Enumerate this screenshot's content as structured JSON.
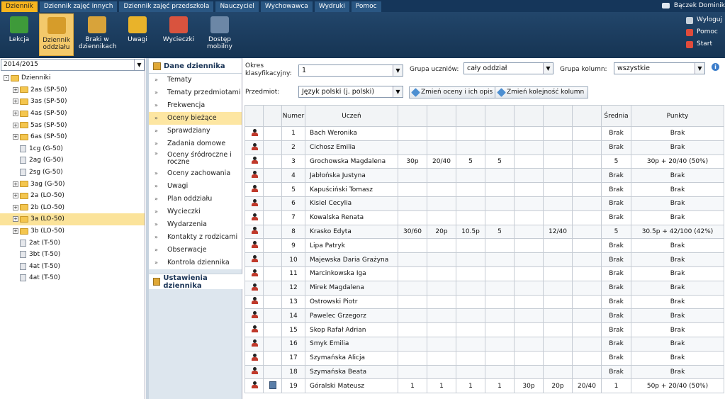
{
  "top_tabs": [
    {
      "label": "Dziennik",
      "active": true
    },
    {
      "label": "Dziennik zajęć innych",
      "active": false
    },
    {
      "label": "Dziennik zajęć przedszkola",
      "active": false
    },
    {
      "label": "Nauczyciel",
      "active": false
    },
    {
      "label": "Wychowawca",
      "active": false
    },
    {
      "label": "Wydruki",
      "active": false
    },
    {
      "label": "Pomoc",
      "active": false
    }
  ],
  "user_name": "Bączek Dominik",
  "toolbar": {
    "buttons": [
      {
        "label1": "Lekcja",
        "label2": "",
        "icon": "blackboard-icon",
        "color": "#3e9a3a"
      },
      {
        "label1": "Dziennik",
        "label2": "oddziału",
        "icon": "book-icon",
        "color": "#d69c2a",
        "active": true
      },
      {
        "label1": "Braki w",
        "label2": "dziennikach",
        "icon": "warning-book-icon",
        "color": "#d8a33a"
      },
      {
        "label1": "Uwagi",
        "label2": "",
        "icon": "note-icon",
        "color": "#e9b32a"
      },
      {
        "label1": "Wycieczki",
        "label2": "",
        "icon": "backpack-icon",
        "color": "#d9533e"
      },
      {
        "label1": "Dostęp",
        "label2": "mobilny",
        "icon": "mobile-icon",
        "color": "#6c87a6"
      }
    ]
  },
  "right_links": [
    {
      "label": "Wyloguj",
      "icon": "lock-icon",
      "color": "#c8d2dc"
    },
    {
      "label": "Pomoc",
      "icon": "lifebuoy-icon",
      "color": "#e04b3b"
    },
    {
      "label": "Start",
      "icon": "home-icon",
      "color": "#e04b3b"
    }
  ],
  "sidebar": {
    "year": "2014/2015",
    "tree": [
      {
        "label": "Dzienniki",
        "level": 0,
        "expander": "-",
        "type": "folder"
      },
      {
        "label": "2as (SP-50)",
        "level": 1,
        "expander": "+",
        "type": "folder"
      },
      {
        "label": "3as (SP-50)",
        "level": 1,
        "expander": "+",
        "type": "folder"
      },
      {
        "label": "4as (SP-50)",
        "level": 1,
        "expander": "+",
        "type": "folder"
      },
      {
        "label": "5as (SP-50)",
        "level": 1,
        "expander": "+",
        "type": "folder"
      },
      {
        "label": "6as (SP-50)",
        "level": 1,
        "expander": "+",
        "type": "folder"
      },
      {
        "label": "1cg (G-50)",
        "level": 1,
        "expander": "",
        "type": "doc"
      },
      {
        "label": "2ag (G-50)",
        "level": 1,
        "expander": "",
        "type": "doc"
      },
      {
        "label": "2sg (G-50)",
        "level": 1,
        "expander": "",
        "type": "doc"
      },
      {
        "label": "3ag (G-50)",
        "level": 1,
        "expander": "+",
        "type": "folder"
      },
      {
        "label": "2a (LO-50)",
        "level": 1,
        "expander": "+",
        "type": "folder"
      },
      {
        "label": "2b (LO-50)",
        "level": 1,
        "expander": "+",
        "type": "folder"
      },
      {
        "label": "3a (LO-50)",
        "level": 1,
        "expander": "+",
        "type": "folder",
        "selected": true
      },
      {
        "label": "3b (LO-50)",
        "level": 1,
        "expander": "+",
        "type": "folder"
      },
      {
        "label": "2at (T-50)",
        "level": 1,
        "expander": "",
        "type": "doc"
      },
      {
        "label": "3bt (T-50)",
        "level": 1,
        "expander": "",
        "type": "doc"
      },
      {
        "label": "4at (T-50)",
        "level": 1,
        "expander": "",
        "type": "doc"
      },
      {
        "label": "4at (T-50)",
        "level": 1,
        "expander": "",
        "type": "doc"
      }
    ]
  },
  "nav": {
    "header": "Dane dziennika",
    "items": [
      {
        "label": "Tematy"
      },
      {
        "label": "Tematy przedmiotami"
      },
      {
        "label": "Frekwencja"
      },
      {
        "label": "Oceny bieżące",
        "active": true
      },
      {
        "label": "Sprawdziany"
      },
      {
        "label": "Zadania domowe"
      },
      {
        "label": "Oceny śródroczne i roczne",
        "double": true
      },
      {
        "label": "Oceny zachowania"
      },
      {
        "label": "Uwagi"
      },
      {
        "label": "Plan oddziału"
      },
      {
        "label": "Wycieczki"
      },
      {
        "label": "Wydarzenia"
      },
      {
        "label": "Kontakty z rodzicami"
      },
      {
        "label": "Obserwacje"
      },
      {
        "label": "Kontrola dziennika"
      }
    ],
    "footer": "Ustawienia dziennika"
  },
  "filters": {
    "okres_label": "Okres klasyfikacyjny:",
    "okres_value": "1",
    "grupa_uczniow_label": "Grupa uczniów:",
    "grupa_uczniow_value": "cały oddział",
    "grupa_kolumn_label": "Grupa kolumn:",
    "grupa_kolumn_value": "wszystkie",
    "przedmiot_label": "Przedmiot:",
    "przedmiot_value": "Język polski (j. polski)",
    "btn_zmien_oceny": "Zmień oceny i ich opis",
    "btn_zmien_kolejnosc": "Zmień kolejność kolumn"
  },
  "table": {
    "headers": [
      "",
      "",
      "Numer",
      "Uczeń",
      "",
      "",
      "",
      "",
      "",
      "",
      "",
      "Średnia",
      "Punkty"
    ],
    "rows": [
      {
        "num": "1",
        "name": "Bach Weronika",
        "grades": [
          "",
          "",
          "",
          "",
          "",
          "",
          ""
        ],
        "avg": "Brak",
        "pts": "Brak"
      },
      {
        "num": "2",
        "name": "Cichosz Emilia",
        "grades": [
          "",
          "",
          "",
          "",
          "",
          "",
          ""
        ],
        "avg": "Brak",
        "pts": "Brak"
      },
      {
        "num": "3",
        "name": "Grochowska Magdalena",
        "grades": [
          "30p",
          "20/40",
          "5",
          "5",
          "",
          "",
          ""
        ],
        "avg": "5",
        "pts": "30p + 20/40 (50%)"
      },
      {
        "num": "4",
        "name": "Jabłońska Justyna",
        "grades": [
          "",
          "",
          "",
          "",
          "",
          "",
          ""
        ],
        "avg": "Brak",
        "pts": "Brak"
      },
      {
        "num": "5",
        "name": "Kapuściński Tomasz",
        "grades": [
          "",
          "",
          "",
          "",
          "",
          "",
          ""
        ],
        "avg": "Brak",
        "pts": "Brak"
      },
      {
        "num": "6",
        "name": "Kisiel Cecylia",
        "grades": [
          "",
          "",
          "",
          "",
          "",
          "",
          ""
        ],
        "avg": "Brak",
        "pts": "Brak"
      },
      {
        "num": "7",
        "name": "Kowalska Renata",
        "grades": [
          "",
          "",
          "",
          "",
          "",
          "",
          ""
        ],
        "avg": "Brak",
        "pts": "Brak"
      },
      {
        "num": "8",
        "name": "Krasko Edyta",
        "grades": [
          "30/60",
          "20p",
          "10.5p",
          "5",
          "",
          "12/40",
          ""
        ],
        "avg": "5",
        "pts": "30.5p + 42/100 (42%)"
      },
      {
        "num": "9",
        "name": "Lipa Patryk",
        "grades": [
          "",
          "",
          "",
          "",
          "",
          "",
          ""
        ],
        "avg": "Brak",
        "pts": "Brak"
      },
      {
        "num": "10",
        "name": "Majewska Daria Grażyna",
        "grades": [
          "",
          "",
          "",
          "",
          "",
          "",
          ""
        ],
        "avg": "Brak",
        "pts": "Brak"
      },
      {
        "num": "11",
        "name": "Marcinkowska Iga",
        "grades": [
          "",
          "",
          "",
          "",
          "",
          "",
          ""
        ],
        "avg": "Brak",
        "pts": "Brak"
      },
      {
        "num": "12",
        "name": "Mirek Magdalena",
        "grades": [
          "",
          "",
          "",
          "",
          "",
          "",
          ""
        ],
        "avg": "Brak",
        "pts": "Brak"
      },
      {
        "num": "13",
        "name": "Ostrowski Piotr",
        "grades": [
          "",
          "",
          "",
          "",
          "",
          "",
          ""
        ],
        "avg": "Brak",
        "pts": "Brak"
      },
      {
        "num": "14",
        "name": "Pawelec Grzegorz",
        "grades": [
          "",
          "",
          "",
          "",
          "",
          "",
          ""
        ],
        "avg": "Brak",
        "pts": "Brak"
      },
      {
        "num": "15",
        "name": "Skop Rafał Adrian",
        "grades": [
          "",
          "",
          "",
          "",
          "",
          "",
          ""
        ],
        "avg": "Brak",
        "pts": "Brak"
      },
      {
        "num": "16",
        "name": "Smyk Emilia",
        "grades": [
          "",
          "",
          "",
          "",
          "",
          "",
          ""
        ],
        "avg": "Brak",
        "pts": "Brak"
      },
      {
        "num": "17",
        "name": "Szymańska Alicja",
        "grades": [
          "",
          "",
          "",
          "",
          "",
          "",
          ""
        ],
        "avg": "Brak",
        "pts": "Brak"
      },
      {
        "num": "18",
        "name": "Szymańska Beata",
        "grades": [
          "",
          "",
          "",
          "",
          "",
          "",
          ""
        ],
        "avg": "Brak",
        "pts": "Brak"
      },
      {
        "num": "19",
        "name": "Góralski Mateusz",
        "grades": [
          "1",
          "1",
          "1",
          "1",
          "30p",
          "20p",
          "20/40"
        ],
        "avg": "1",
        "pts": "50p + 20/40 (50%)",
        "doc": true
      }
    ]
  }
}
